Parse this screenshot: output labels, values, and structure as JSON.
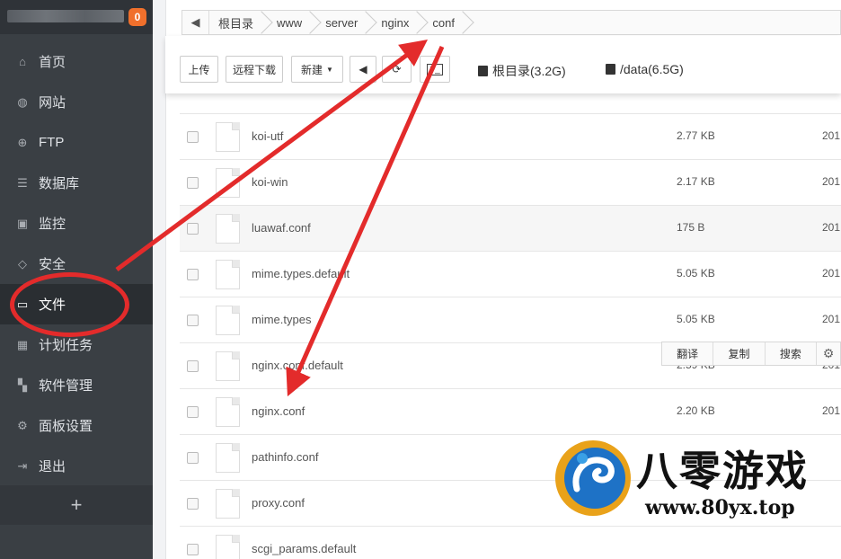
{
  "sidebar": {
    "badge": "0",
    "items": [
      {
        "label": "首页",
        "icon": "home-icon"
      },
      {
        "label": "网站",
        "icon": "globe-icon"
      },
      {
        "label": "FTP",
        "icon": "ftp-icon"
      },
      {
        "label": "数据库",
        "icon": "database-icon"
      },
      {
        "label": "监控",
        "icon": "monitor-icon"
      },
      {
        "label": "安全",
        "icon": "shield-icon"
      },
      {
        "label": "文件",
        "icon": "folder-icon",
        "active": true
      },
      {
        "label": "计划任务",
        "icon": "calendar-icon"
      },
      {
        "label": "软件管理",
        "icon": "grid-icon"
      },
      {
        "label": "面板设置",
        "icon": "gear-icon"
      },
      {
        "label": "退出",
        "icon": "exit-icon"
      }
    ],
    "add_label": "+"
  },
  "breadcrumb": {
    "back_icon": "arrow-left-icon",
    "items": [
      "根目录",
      "www",
      "server",
      "nginx",
      "conf"
    ]
  },
  "toolbar": {
    "upload_label": "上传",
    "remote_download_label": "远程下载",
    "new_label": "新建",
    "disks": [
      "根目录(3.2G)",
      "/data(6.5G)"
    ]
  },
  "files": [
    {
      "name": "koi-utf",
      "size": "2.77 KB",
      "date": "201"
    },
    {
      "name": "koi-win",
      "size": "2.17 KB",
      "date": "201"
    },
    {
      "name": "luawaf.conf",
      "size": "175 B",
      "date": "201"
    },
    {
      "name": "mime.types.default",
      "size": "5.05 KB",
      "date": "201"
    },
    {
      "name": "mime.types",
      "size": "5.05 KB",
      "date": "201"
    },
    {
      "name": "nginx.conf.default",
      "size": "2.59 KB",
      "date": "201"
    },
    {
      "name": "nginx.conf",
      "size": "2.20 KB",
      "date": "201"
    },
    {
      "name": "pathinfo.conf",
      "size": "",
      "date": ""
    },
    {
      "name": "proxy.conf",
      "size": "",
      "date": ""
    },
    {
      "name": "scgi_params.default",
      "size": "",
      "date": ""
    }
  ],
  "popup": {
    "translate": "翻译",
    "copy": "复制",
    "search": "搜索"
  },
  "watermark": {
    "title": "八零游戏",
    "url": "www.80yx.top"
  },
  "colors": {
    "annotation": "#e32b2b",
    "badge": "#f0702c",
    "sidebar": "#3a3f44"
  }
}
